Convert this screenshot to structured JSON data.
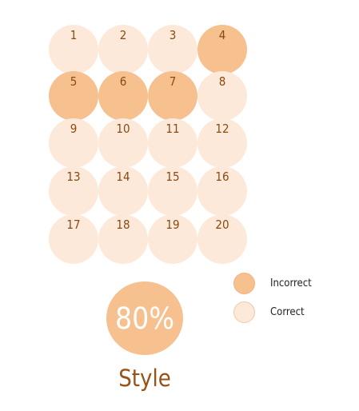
{
  "questions": [
    {
      "number": "1",
      "status": "correct"
    },
    {
      "number": "2",
      "status": "correct"
    },
    {
      "number": "3",
      "status": "correct"
    },
    {
      "number": "4",
      "status": "incorrect"
    },
    {
      "number": "5",
      "status": "incorrect"
    },
    {
      "number": "6",
      "status": "incorrect"
    },
    {
      "number": "7",
      "status": "incorrect"
    },
    {
      "number": "8",
      "status": "correct"
    },
    {
      "number": "9",
      "status": "correct"
    },
    {
      "number": "10",
      "status": "correct"
    },
    {
      "number": "11",
      "status": "correct"
    },
    {
      "number": "12",
      "status": "correct"
    },
    {
      "number": "13",
      "status": "correct"
    },
    {
      "number": "14",
      "status": "correct"
    },
    {
      "number": "15",
      "status": "correct"
    },
    {
      "number": "16",
      "status": "correct"
    },
    {
      "number": "17",
      "status": "correct"
    },
    {
      "number": "18",
      "status": "correct"
    },
    {
      "number": "19",
      "status": "correct"
    },
    {
      "number": "20",
      "status": "correct"
    }
  ],
  "legend": {
    "incorrect_label": "Incorrect",
    "correct_label": "Correct"
  },
  "score": {
    "value": "80%"
  },
  "category": "Style",
  "colors": {
    "incorrect": "#f7c08f",
    "correct": "#fde9d9",
    "label_text": "#8a4a12",
    "title_text": "#9a5114",
    "score_text": "#ffffff"
  }
}
